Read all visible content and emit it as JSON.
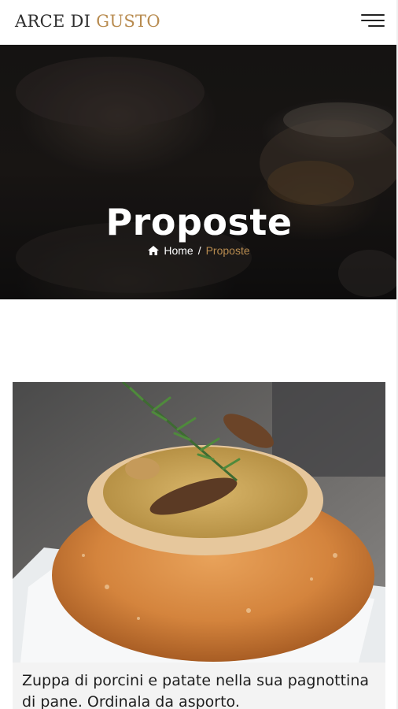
{
  "header": {
    "logo_part1": "ARCE DI",
    "logo_part2": "GUSTO",
    "menu_icon": "hamburger-menu-icon"
  },
  "hero": {
    "title": "Proposte",
    "breadcrumb": {
      "home_icon": "home-icon",
      "home_label": "Home",
      "separator": "/",
      "current_label": "Proposte"
    }
  },
  "card": {
    "caption": "Zuppa di porcini e patate nella sua pagnottina di pane. Ordinala da asporto."
  },
  "colors": {
    "accent": "#b88b4f",
    "text_dark": "#2d2d2d",
    "caption_bg": "#f3f3f3"
  }
}
